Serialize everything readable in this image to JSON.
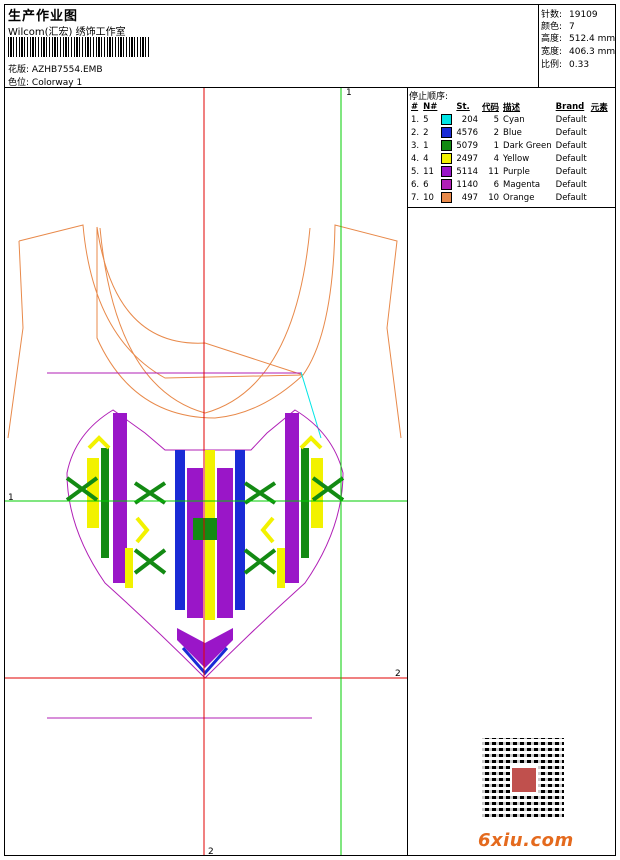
{
  "header": {
    "title": "生产作业图",
    "company": "Wilcom(汇宏) 绣饰工作室",
    "design_label": "花版:",
    "design_value": "AZHB7554.EMB",
    "colorway_label": "色位:",
    "colorway_value": "Colorway 1"
  },
  "meta": {
    "stitches": {
      "label": "针数:",
      "value": "19109"
    },
    "colors": {
      "label": "颜色:",
      "value": "7"
    },
    "height": {
      "label": "高度:",
      "value": "512.4 mm"
    },
    "width": {
      "label": "宽度:",
      "value": "406.3 mm"
    },
    "scale": {
      "label": "比例:",
      "value": "0.33"
    }
  },
  "stop_sequence": {
    "title": "停止顺序:",
    "headers": [
      "#",
      "N#",
      "St.",
      "代码",
      "描述",
      "Brand",
      "元素"
    ],
    "rows": [
      {
        "idx": "1.",
        "n": "5",
        "st": "204",
        "code": "5",
        "desc": "Cyan",
        "brand": "Default",
        "color": "#00e5e5"
      },
      {
        "idx": "2.",
        "n": "2",
        "st": "4576",
        "code": "2",
        "desc": "Blue",
        "brand": "Default",
        "color": "#1a2bd6"
      },
      {
        "idx": "3.",
        "n": "1",
        "st": "5079",
        "code": "1",
        "desc": "Dark Green",
        "brand": "Default",
        "color": "#138a13"
      },
      {
        "idx": "4.",
        "n": "4",
        "st": "2497",
        "code": "4",
        "desc": "Yellow",
        "brand": "Default",
        "color": "#f2f200"
      },
      {
        "idx": "5.",
        "n": "11",
        "st": "5114",
        "code": "11",
        "desc": "Purple",
        "brand": "Default",
        "color": "#9a16c8"
      },
      {
        "idx": "6.",
        "n": "6",
        "st": "1140",
        "code": "6",
        "desc": "Magenta",
        "brand": "Default",
        "color": "#b01fb6"
      },
      {
        "idx": "7.",
        "n": "10",
        "st": "497",
        "code": "10",
        "desc": "Orange",
        "brand": "Default",
        "color": "#e8894a"
      }
    ]
  },
  "canvas": {
    "axis_labels": {
      "top_green": "1",
      "left_green": "1",
      "right_red": "2",
      "bottom_red": "2"
    }
  },
  "watermark": "6xiu.com",
  "colors": {
    "guide_red": "#e00000",
    "guide_green": "#00cc00",
    "outline_orange": "#e8894a",
    "baseline_purple": "#b01fb6"
  }
}
